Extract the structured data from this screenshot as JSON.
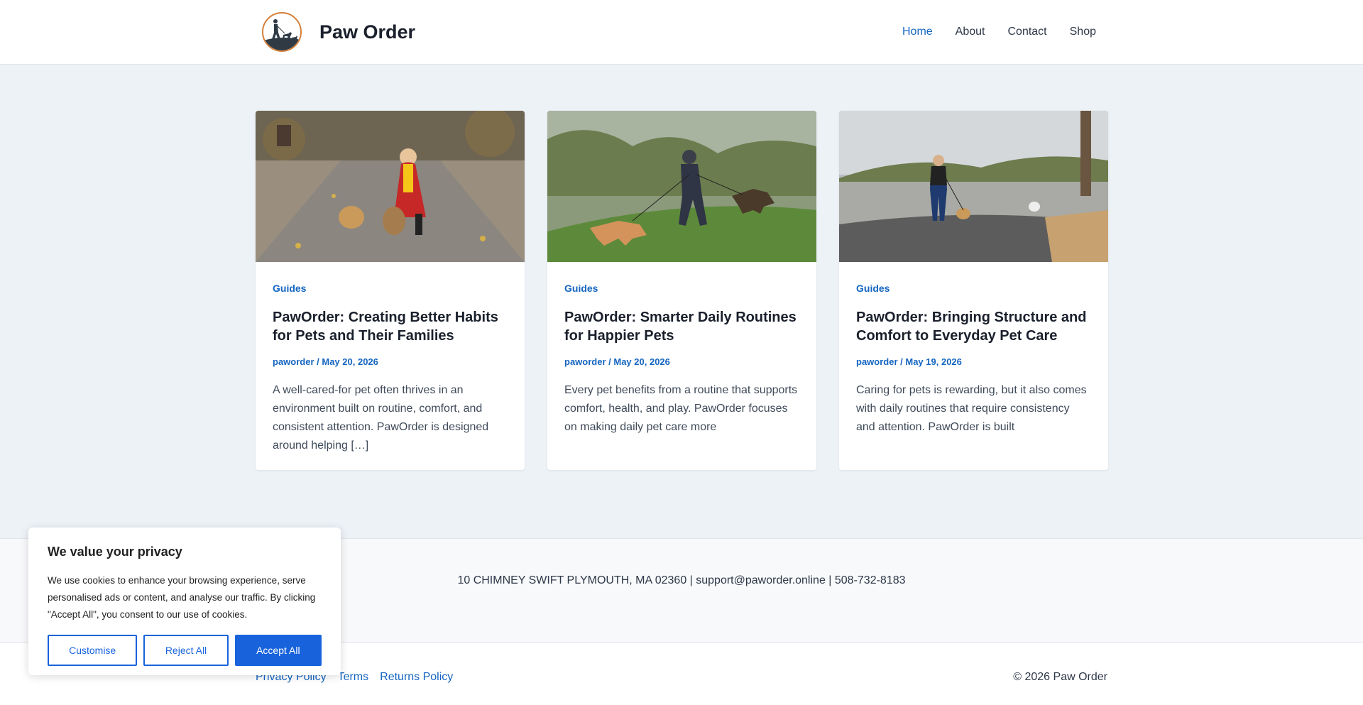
{
  "header": {
    "title": "Paw Order",
    "nav": [
      "Home",
      "About",
      "Contact",
      "Shop"
    ],
    "active_nav": "Home"
  },
  "posts": [
    {
      "category": "Guides",
      "title": "PawOrder: Creating Better Habits for Pets and Their Families",
      "author": "paworder",
      "date": "May 20, 2026",
      "excerpt": "A well-cared-for pet often thrives in an environment built on routine, comfort, and consistent attention. PawOrder is designed around helping […]"
    },
    {
      "category": "Guides",
      "title": "PawOrder: Smarter Daily Routines for Happier Pets",
      "author": "paworder",
      "date": "May 20, 2026",
      "excerpt": "Every pet benefits from a routine that supports comfort, health, and play. PawOrder focuses on making daily pet care more"
    },
    {
      "category": "Guides",
      "title": "PawOrder: Bringing Structure and Comfort to Everyday Pet Care",
      "author": "paworder",
      "date": "May 19, 2026",
      "excerpt": "Caring for pets is rewarding, but it also comes with daily routines that require consistency and attention. PawOrder is built"
    }
  ],
  "footer": {
    "address": "10 CHIMNEY SWIFT PLYMOUTH, MA 02360 | support@paworder.online | 508-732-8183",
    "links": [
      "Privacy Policy",
      "Terms",
      "Returns Policy"
    ],
    "copyright": "© 2026 Paw Order"
  },
  "cookie": {
    "title": "We value your privacy",
    "text": "We use cookies to enhance your browsing experience, serve personalised ads or content, and analyse our traffic. By clicking \"Accept All\", you consent to our use of cookies.",
    "customise": "Customise",
    "reject": "Reject All",
    "accept": "Accept All"
  },
  "colors": {
    "accent": "#1565c0",
    "cookie_button": "#1863dc",
    "page_bg": "#edf2f7"
  },
  "icons": {
    "logo": "dog-walker-logo-icon"
  }
}
